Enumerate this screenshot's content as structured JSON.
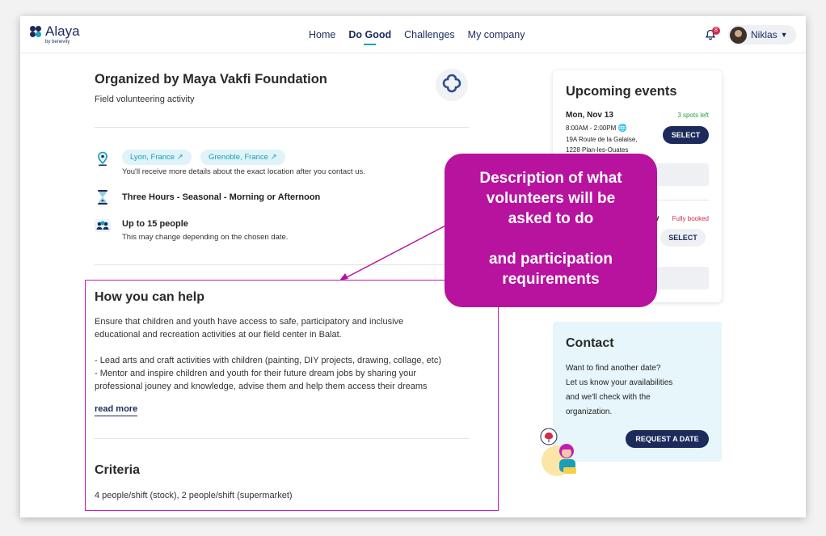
{
  "header": {
    "brand": "Alaya",
    "brand_sub": "by benevity",
    "nav": [
      "Home",
      "Do Good",
      "Challenges",
      "My company"
    ],
    "active_nav": "Do Good",
    "notification_count": "8",
    "user_name": "Niklas"
  },
  "activity": {
    "title": "Organized by Maya Vakfi Foundation",
    "subtitle": "Field volunteering activity",
    "locations": [
      "Lyon, France",
      "Grenoble, France"
    ],
    "location_note": "You'll receive more details about the exact location after you contact us.",
    "duration": "Three Hours - Seasonal - Morning or Afternoon",
    "capacity": "Up to 15 people",
    "capacity_note": "This may change depending on the chosen date."
  },
  "help": {
    "heading": "How you can help",
    "line1": "Ensure that children and youth have access to safe, participatory and inclusive",
    "line2": "educational and recreation activities at our field center in Balat.",
    "line3": "- Lead arts and craft activities with children (painting, DIY projects, drawing, collage, etc)",
    "line4": "- Mentor and inspire children and youth for their future dream jobs by sharing your",
    "line5": "professional jouney and knowledge, advise them and help them access their dreams",
    "read_more": "read more"
  },
  "criteria": {
    "heading": "Criteria",
    "text": "4 people/shift (stock), 2 people/shift (supermarket)"
  },
  "events": {
    "heading": "Upcoming events",
    "first": {
      "date": "Mon, Nov 13",
      "spots": "3 spots left",
      "time": "8:00AM - 2:00PM",
      "address1": "19A Route de la Galaise,",
      "address2": "1228 Plan-les-Ouates",
      "button": "SELECT"
    },
    "second": {
      "date_suffix": "v",
      "status": "Fully booked",
      "button": "SELECT"
    }
  },
  "callout": {
    "line1": "Description of what",
    "line2": "volunteers will be",
    "line3": "asked to do",
    "line4": "and participation",
    "line5": "requirements"
  },
  "contact": {
    "heading": "Contact",
    "text1": "Want to find another date?",
    "text2": "Let us know your availabilities",
    "text3": "and we'll check with the",
    "text4": "organization.",
    "button": "REQUEST A DATE"
  },
  "colors": {
    "brand_navy": "#1c2a5c",
    "accent_teal": "#1a9fb8",
    "callout_magenta": "#b8139e",
    "available_green": "#2c9a44",
    "booked_red": "#d12b4a"
  }
}
